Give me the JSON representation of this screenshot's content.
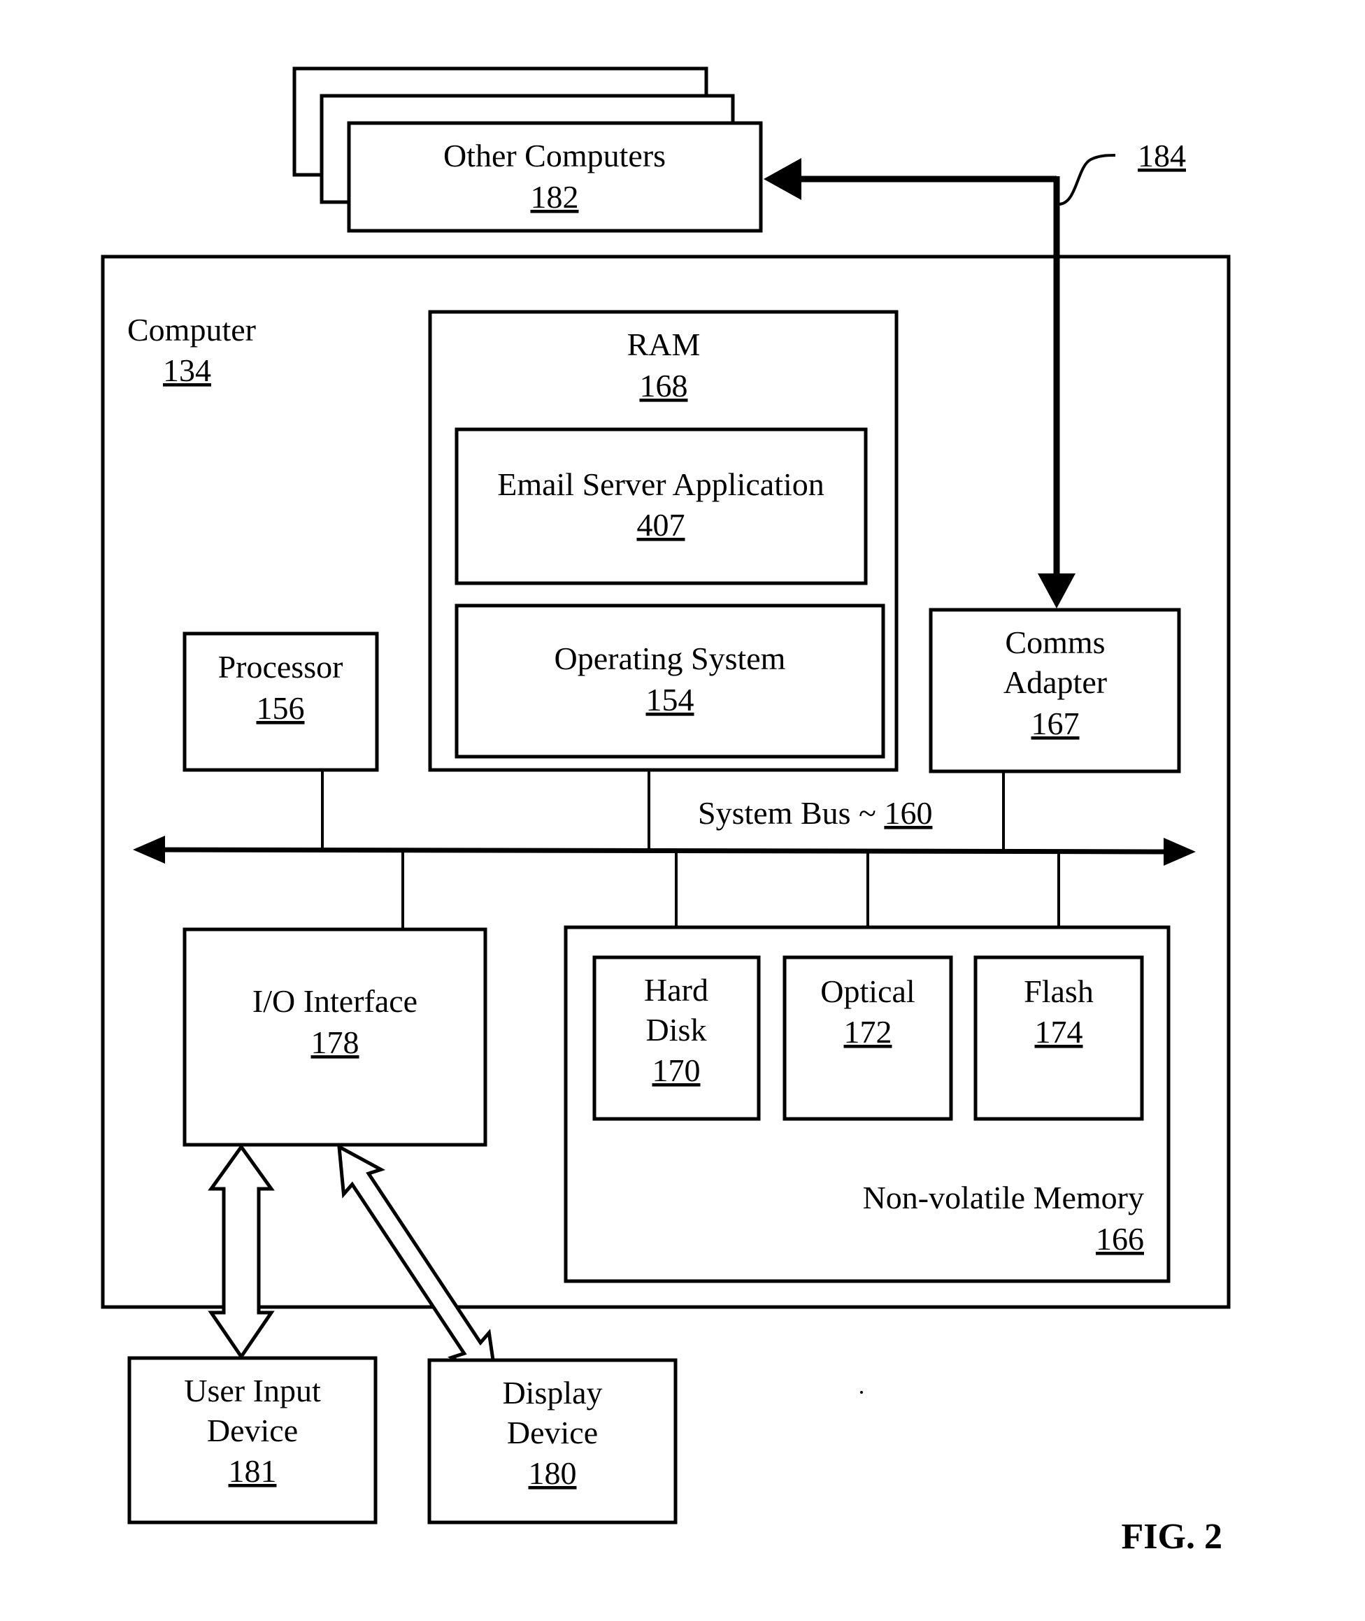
{
  "figure": {
    "caption": "FIG. 2"
  },
  "other_computers": {
    "label": "Other Computers",
    "ref": "182"
  },
  "network": {
    "ref": "184"
  },
  "computer": {
    "label": "Computer",
    "ref": "134"
  },
  "ram": {
    "label": "RAM",
    "ref": "168"
  },
  "email_server": {
    "label": "Email Server Application",
    "ref": "407"
  },
  "operating_system": {
    "label": "Operating System",
    "ref": "154"
  },
  "processor": {
    "label": "Processor",
    "ref": "156"
  },
  "comms_adapter": {
    "label_line1": "Comms",
    "label_line2": "Adapter",
    "ref": "167"
  },
  "system_bus": {
    "label": "System Bus ~ ",
    "ref": "160"
  },
  "io_interface": {
    "label": "I/O Interface",
    "ref": "178"
  },
  "nonvolatile_memory": {
    "label": "Non-volatile Memory",
    "ref": "166"
  },
  "hard_disk": {
    "label_line1": "Hard",
    "label_line2": "Disk",
    "ref": "170"
  },
  "optical": {
    "label": "Optical",
    "ref": "172"
  },
  "flash": {
    "label": "Flash",
    "ref": "174"
  },
  "user_input_device": {
    "label_line1": "User Input",
    "label_line2": "Device",
    "ref": "181"
  },
  "display_device": {
    "label_line1": "Display",
    "label_line2": "Device",
    "ref": "180"
  }
}
